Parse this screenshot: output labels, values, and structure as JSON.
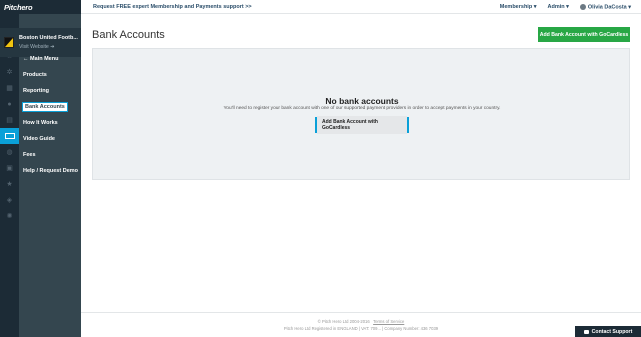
{
  "brand": {
    "name": "Pitchero"
  },
  "club": {
    "name": "Boston United Footb...",
    "visit_label": "Visit Website ➔"
  },
  "sidebar": {
    "items": [
      {
        "label": "← Main Menu"
      },
      {
        "label": "Products"
      },
      {
        "label": "Reporting"
      },
      {
        "label": "Bank Accounts"
      },
      {
        "label": "How It Works"
      },
      {
        "label": "Video Guide"
      },
      {
        "label": "Fees"
      },
      {
        "label": "Help / Request Demo"
      }
    ]
  },
  "topbar": {
    "promo": "Request FREE expert Membership and Payments support >>",
    "membership": "Membership ▾",
    "admin": "Admin ▾",
    "user": "Olivia DaCosta ▾"
  },
  "page": {
    "title": "Bank Accounts",
    "add_button": "Add Bank Account with GoCardless"
  },
  "empty_state": {
    "title": "No bank accounts",
    "description": "You'll need to register your bank account with one of our supported payment providers in order to accept payments in your country.",
    "button": "Add Bank Account with GoCardless"
  },
  "footer": {
    "copyright": "© Pitch Hero Ltd 2004-2016",
    "terms": "Terms of Service",
    "company": "Pitch Hero Ltd Registered in ENGLAND | VAT: 709... | Company Number: 436 7039"
  },
  "support": {
    "label": "Contact Support"
  },
  "colors": {
    "accent": "#0aa0d8",
    "sidebar": "#34464f",
    "rail": "#1c2b36",
    "primary_button": "#28a745"
  }
}
